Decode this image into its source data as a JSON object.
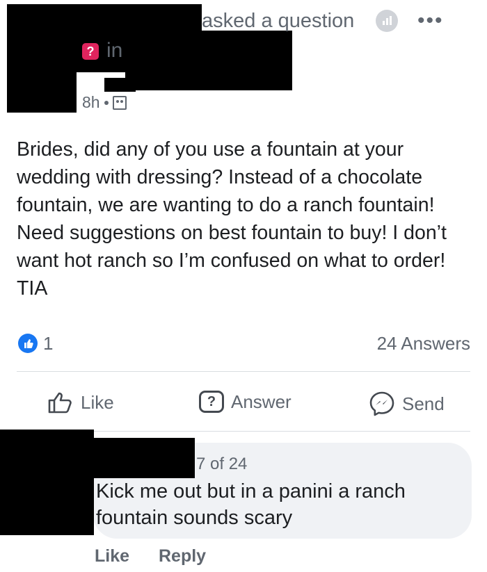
{
  "post": {
    "header_action": "asked a question",
    "group_prefix": "in",
    "question_badge": "?",
    "time": "8h",
    "body": "Brides, did any of you use a fountain at your wedding with dressing? Instead of a chocolate fountain, we are wanting to do a ranch fountain! Need suggestions on best fountain to buy! I don’t want hot ranch so I’m confused on what to order! TIA",
    "reaction_count": "1",
    "answers_count": "24 Answers"
  },
  "actions": {
    "like": "Like",
    "answer": "Answer",
    "send": "Send"
  },
  "comment": {
    "meta": "7 of 24",
    "text": "Kick me out but in a panini a ranch fountain sounds scary",
    "like": "Like",
    "reply": "Reply"
  },
  "icons": {
    "more": "more-options-icon",
    "signal": "signal-icon",
    "audience": "group-audience-icon",
    "like": "thumbs-up-icon",
    "answer": "question-icon",
    "send": "messenger-icon"
  },
  "colors": {
    "accent": "#1877f2",
    "question_badge": "#e0245e",
    "muted_text": "#606770",
    "bubble": "#f0f2f5"
  }
}
